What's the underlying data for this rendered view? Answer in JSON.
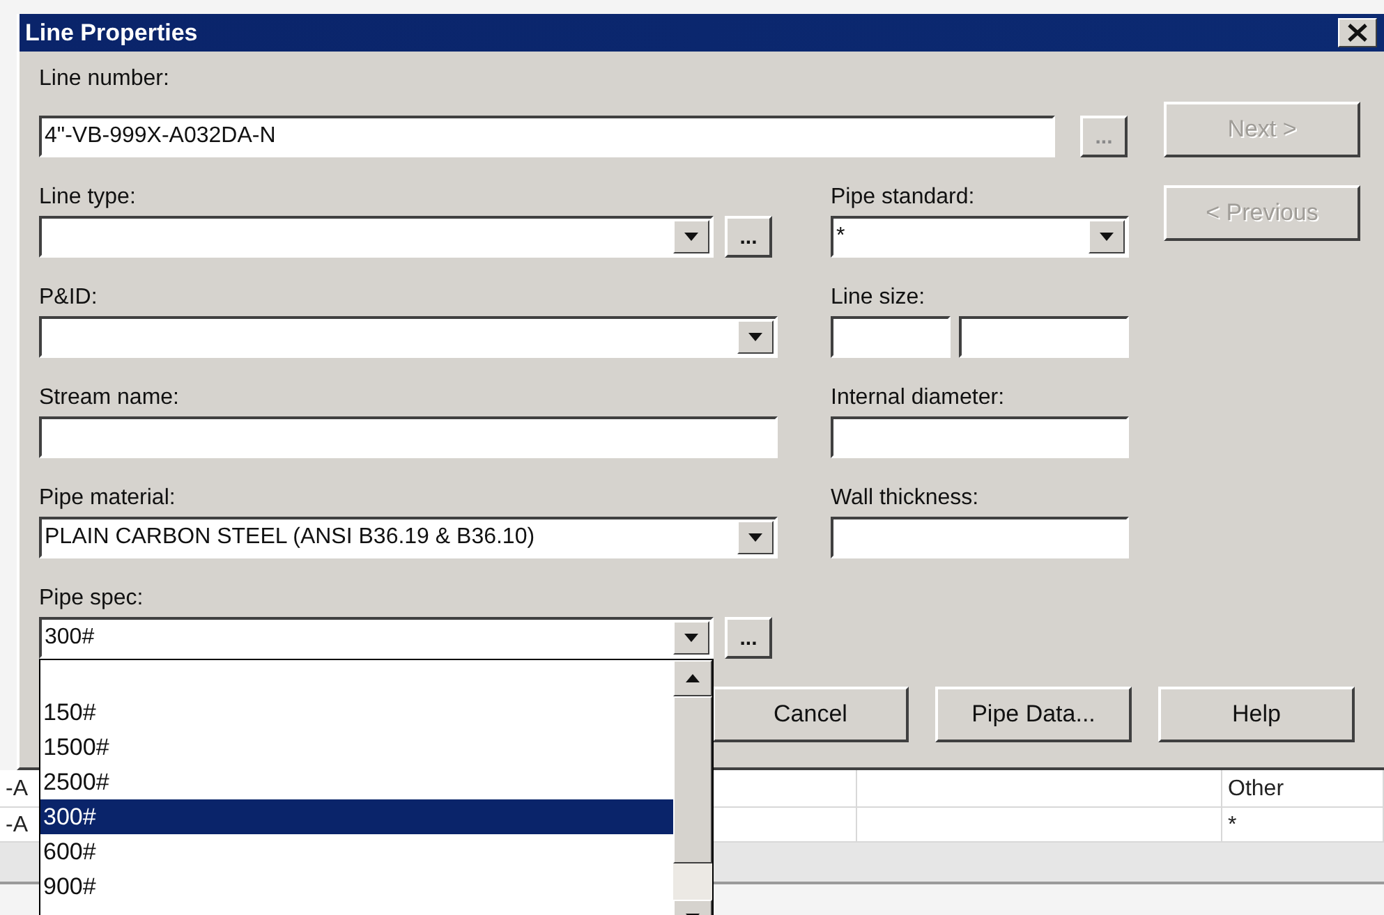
{
  "window": {
    "title": "Line Properties"
  },
  "line_number": {
    "label": "Line number:",
    "value": "4\"-VB-999X-A032DA-N",
    "browse": "..."
  },
  "line_type": {
    "label": "Line type:",
    "browse": "..."
  },
  "pipe_standard": {
    "label": "Pipe standard:",
    "value": "*"
  },
  "pid": {
    "label": "P&ID:"
  },
  "line_size": {
    "label": "Line size:"
  },
  "stream_name": {
    "label": "Stream name:"
  },
  "internal_diameter": {
    "label": "Internal diameter:"
  },
  "pipe_material": {
    "label": "Pipe material:",
    "value": "PLAIN CARBON STEEL (ANSI B36.19 & B36.10)"
  },
  "wall_thickness": {
    "label": "Wall thickness:"
  },
  "pipe_spec": {
    "label": "Pipe spec:",
    "value": "300#",
    "browse": "..."
  },
  "nav_buttons": [
    {
      "label": "Next >",
      "disabled": true
    },
    {
      "label": "< Previous",
      "disabled": true
    }
  ],
  "action_buttons": [
    "Cancel",
    "Pipe Data...",
    "Help"
  ],
  "pipe_spec_list": {
    "items": [
      {
        "label": "150#",
        "selected": false
      },
      {
        "label": "1500#",
        "selected": false
      },
      {
        "label": "2500#",
        "selected": false
      },
      {
        "label": "300#",
        "selected": true
      },
      {
        "label": "600#",
        "selected": false
      },
      {
        "label": "900#",
        "selected": false
      }
    ]
  },
  "background_table": {
    "rows": [
      {
        "column_1": "-A",
        "column_3": "Other"
      },
      {
        "column_1": "-A",
        "column_3": "*"
      }
    ]
  }
}
